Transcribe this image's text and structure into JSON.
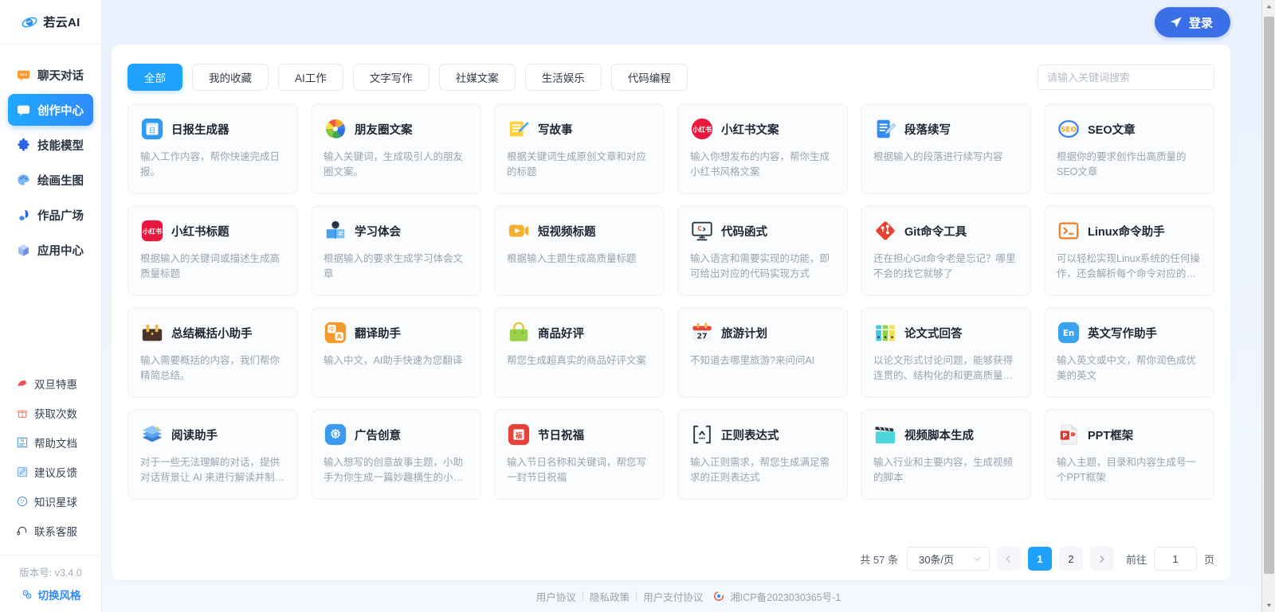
{
  "brand": {
    "name": "若云AI",
    "logo_icon": "cloud-swirl-icon"
  },
  "sidebar": {
    "nav": [
      {
        "label": "聊天对话",
        "icon": "chat-bubble-icon",
        "active": false
      },
      {
        "label": "创作中心",
        "icon": "create-pen-icon",
        "active": true
      },
      {
        "label": "技能模型",
        "icon": "puzzle-piece-icon",
        "active": false
      },
      {
        "label": "绘画生图",
        "icon": "palette-icon",
        "active": false
      },
      {
        "label": "作品广场",
        "icon": "megaphone-icon",
        "active": false
      },
      {
        "label": "应用中心",
        "icon": "cube-icon",
        "active": false
      }
    ],
    "bottom": [
      {
        "label": "双旦特惠",
        "icon": "santa-hat-icon"
      },
      {
        "label": "获取次数",
        "icon": "gift-box-icon"
      },
      {
        "label": "帮助文档",
        "icon": "document-icon"
      },
      {
        "label": "建议反馈",
        "icon": "feedback-pencil-icon"
      },
      {
        "label": "知识星球",
        "icon": "planet-icon"
      },
      {
        "label": "联系客服",
        "icon": "headset-icon"
      }
    ],
    "version": "版本号: v3.4.0",
    "theme_switch": {
      "label": "切换风格",
      "icon": "theme-swap-icon"
    }
  },
  "topbar": {
    "login_label": "登录",
    "login_icon": "paper-plane-icon",
    "login_color": "#3b6fe8"
  },
  "tabs": [
    {
      "label": "全部",
      "active": true
    },
    {
      "label": "我的收藏",
      "active": false
    },
    {
      "label": "AI工作",
      "active": false
    },
    {
      "label": "文字写作",
      "active": false
    },
    {
      "label": "社媒文案",
      "active": false
    },
    {
      "label": "生活娱乐",
      "active": false
    },
    {
      "label": "代码编程",
      "active": false
    }
  ],
  "search": {
    "placeholder": "请输入关键词搜索",
    "value": "",
    "icon": "search-icon"
  },
  "cards": [
    {
      "title": "日报生成器",
      "desc": "输入工作内容，帮你快速完成日报。",
      "icon": "daily-report-icon"
    },
    {
      "title": "朋友圈文案",
      "desc": "输入关键词，生成吸引人的朋友圈文案。",
      "icon": "color-shutter-icon"
    },
    {
      "title": "写故事",
      "desc": "根据关键词生成原创文章和对应的标题",
      "icon": "write-story-icon"
    },
    {
      "title": "小红书文案",
      "desc": "输入你想发布的内容，帮你生成小红书风格文案",
      "icon": "xiaohongshu-round-icon"
    },
    {
      "title": "段落续写",
      "desc": "根据输入的段落进行续写内容",
      "icon": "paragraph-continue-icon"
    },
    {
      "title": "SEO文章",
      "desc": "根据你的要求创作出高质量的SEO文章",
      "icon": "seo-icon"
    },
    {
      "title": "小红书标题",
      "desc": "根据输入的关键词或描述生成高质量标题",
      "icon": "xiaohongshu-square-icon"
    },
    {
      "title": "学习体会",
      "desc": "根据输入的要求生成学习体会文章",
      "icon": "study-book-icon"
    },
    {
      "title": "短视频标题",
      "desc": "根据输入主题生成高质量标题",
      "icon": "video-play-icon"
    },
    {
      "title": "代码函式",
      "desc": "输入语言和需要实现的功能，即可给出对应的代码实现方式",
      "icon": "code-monitor-icon"
    },
    {
      "title": "Git命令工具",
      "desc": "还在担心Git命令老是忘记？哪里不会的找它就够了",
      "icon": "git-icon"
    },
    {
      "title": "Linux命令助手",
      "desc": "可以轻松实现Linux系统的任何操作，还会解析每个命令对应的用途",
      "icon": "terminal-icon"
    },
    {
      "title": "总结概括小助手",
      "desc": "输入需要概括的内容，我们帮你精简总结。",
      "icon": "briefcase-icon"
    },
    {
      "title": "翻译助手",
      "desc": "输入中文，AI助手快速为您翻译",
      "icon": "translate-icon"
    },
    {
      "title": "商品好评",
      "desc": "帮您生成超真实的商品好评文案",
      "icon": "shopping-bag-icon"
    },
    {
      "title": "旅游计划",
      "desc": "不知道去哪里旅游?来问问AI",
      "icon": "calendar-27-icon"
    },
    {
      "title": "论文式回答",
      "desc": "以论文形式讨论问题，能够获得连贯的、结构化的和更高质量的回…",
      "icon": "binders-icon"
    },
    {
      "title": "英文写作助手",
      "desc": "输入英文或中文，帮你润色成优美的英文",
      "icon": "english-en-icon"
    },
    {
      "title": "阅读助手",
      "desc": "对于一些无法理解的对话，提供对话背景让 AI 来进行解读并制定出…",
      "icon": "books-stack-icon"
    },
    {
      "title": "广告创意",
      "desc": "输入想写的创意故事主题，小助手为你生成一篇妙趣横生的小故事",
      "icon": "lightbulb-gear-icon"
    },
    {
      "title": "节日祝福",
      "desc": "输入节日名称和关键词，帮您写一封节日祝福",
      "icon": "festival-fu-icon"
    },
    {
      "title": "正则表达式",
      "desc": "输入正则需求，帮您生成满足需求的正则表达式",
      "icon": "regex-brackets-icon"
    },
    {
      "title": "视频脚本生成",
      "desc": "输入行业和主要内容，生成视频的脚本",
      "icon": "clapperboard-icon"
    },
    {
      "title": "PPT框架",
      "desc": "输入主题，目录和内容生成号一个PPT框架",
      "icon": "ppt-file-icon"
    }
  ],
  "pagination": {
    "total_label": "共 57 条",
    "page_size": "30条/页",
    "prev_icon": "chevron-left-icon",
    "next_icon": "chevron-right-icon",
    "pages": [
      "1",
      "2"
    ],
    "current_page": "1",
    "jump_label": "前往",
    "jump_value": "1",
    "jump_unit": "页"
  },
  "footer": {
    "links": [
      "用户协议",
      "隐私政策",
      "用户支付协议"
    ],
    "separator": "|",
    "icp_icon": "police-badge-icon",
    "icp": "湘ICP备2023030365号-1"
  },
  "scrollbar": {
    "up_icon": "caret-up-icon",
    "down_icon": "caret-down-icon"
  }
}
